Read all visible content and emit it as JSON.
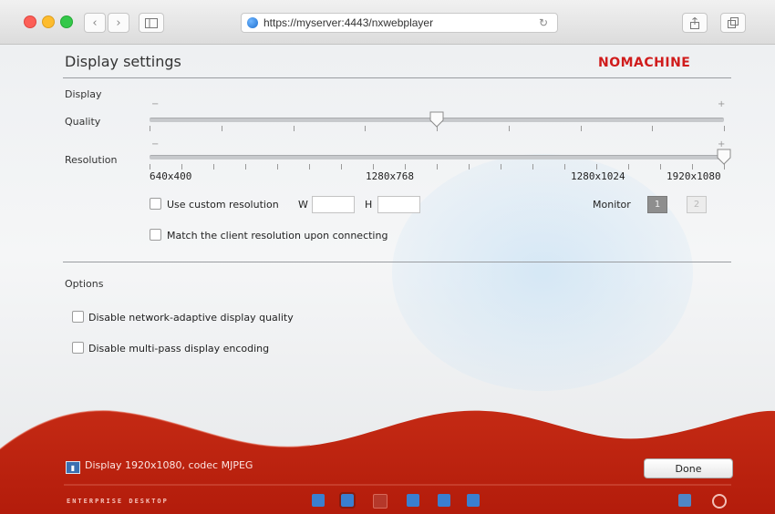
{
  "browser": {
    "url": "https://myserver:4443/nxwebplayer",
    "back_glyph": "‹",
    "forward_glyph": "›"
  },
  "header": {
    "title": "Display settings",
    "logo": "NOMACHINE"
  },
  "display_section": {
    "heading": "Display",
    "quality_label": "Quality",
    "quality_level": 0.5,
    "resolution_label": "Resolution",
    "resolution_level": 1.0,
    "min_sign": "−",
    "max_sign": "+",
    "resolution_ticks": [
      "640x400",
      "1280x768",
      "1280x1024",
      "1920x1080"
    ]
  },
  "custom_resolution": {
    "label": "Use custom resolution",
    "checked": false,
    "w_label": "W",
    "w_value": "",
    "h_label": "H",
    "h_value": ""
  },
  "monitor": {
    "label": "Monitor",
    "options": [
      "1",
      "2"
    ],
    "selected": "1"
  },
  "match_resolution": {
    "label": "Match the client resolution upon connecting",
    "checked": false
  },
  "options_section": {
    "heading": "Options",
    "items": [
      {
        "label": "Disable network-adaptive display quality",
        "checked": false
      },
      {
        "label": "Disable multi-pass display encoding",
        "checked": false
      }
    ]
  },
  "footer": {
    "status_text": "Display 1920x1080, codec MJPEG",
    "done_label": "Done",
    "brand": "ENTERPRISE DESKTOP"
  },
  "colors": {
    "brand_red": "#c0200f",
    "logo_red": "#d01c1c"
  }
}
